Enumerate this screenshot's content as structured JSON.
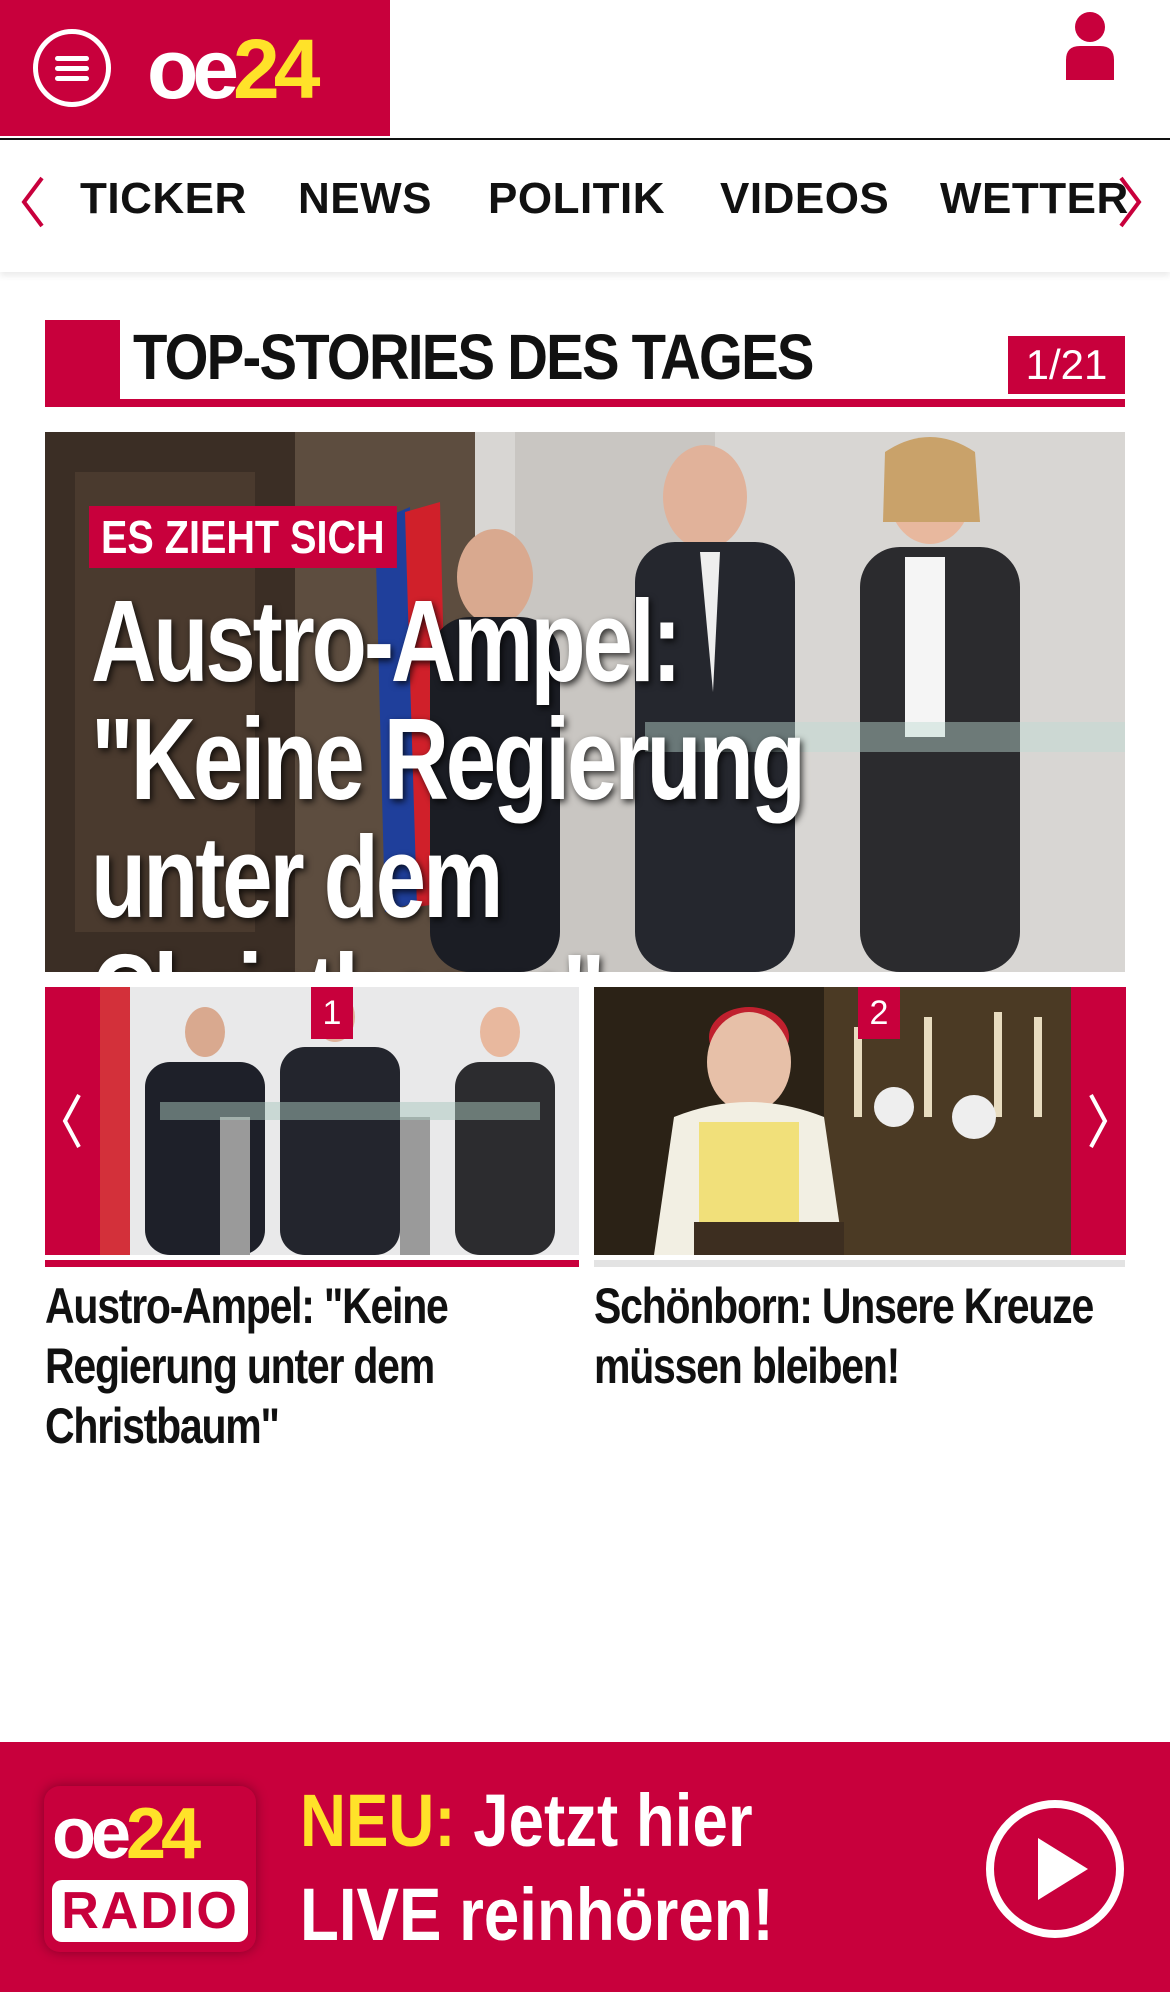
{
  "header": {
    "logo_oe": "oe",
    "logo_num": "24",
    "menu_icon": "hamburger-icon",
    "user_icon": "user-icon"
  },
  "nav": {
    "items": [
      "TICKER",
      "NEWS",
      "POLITIK",
      "VIDEOS",
      "WETTER"
    ],
    "left_arrow_icon": "chevron-left-icon",
    "right_arrow_icon": "chevron-right-icon"
  },
  "top_stories": {
    "title": "TOP-STORIES DES TAGES",
    "counter": "1/21",
    "hero": {
      "kicker": "ES ZIEHT SICH",
      "headline": "Austro-Ampel:\n\"Keine Regierung\nunter dem Christbaum\""
    },
    "cards": [
      {
        "number": "1",
        "title": "Austro-Ampel: \"Keine Regierung unter dem Christbaum\""
      },
      {
        "number": "2",
        "title": "Schönborn: Unsere Kreuze müssen bleiben!"
      }
    ]
  },
  "radio": {
    "logo_oe": "oe",
    "logo_num": "24",
    "logo_label": "RADIO",
    "neu": "NEU:",
    "line1": "Jetzt hier",
    "line2": "LIVE reinhören!",
    "play_icon": "play-icon"
  },
  "colors": {
    "brand_red": "#c8003c",
    "accent_yellow": "#ffe229"
  }
}
